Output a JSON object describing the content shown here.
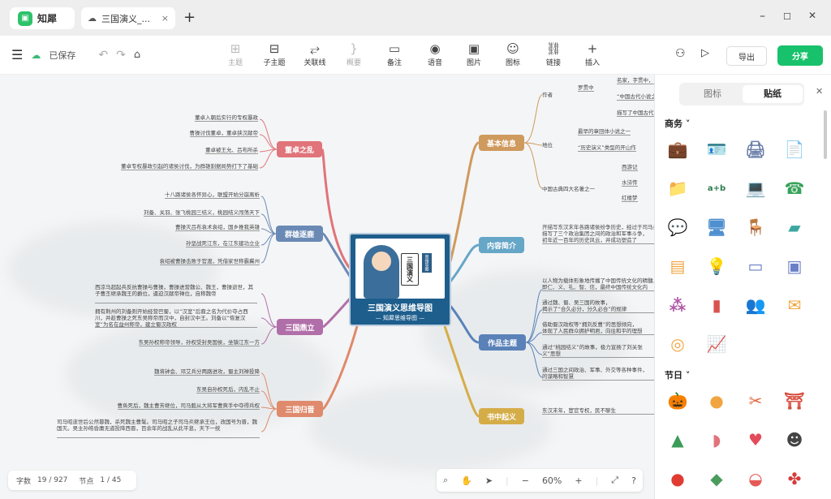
{
  "titlebar": {
    "app_name": "知犀",
    "doc_tab": "三国演义_...",
    "close": "×",
    "new_tab": "+",
    "minimize": "–",
    "maximize": "☐",
    "close_window": "✕"
  },
  "toolbar": {
    "saved_status": "已保存",
    "tools": [
      {
        "label": "主题",
        "icon": "⊞",
        "disabled": true
      },
      {
        "label": "子主题",
        "icon": "⊟",
        "disabled": false
      },
      {
        "label": "关联线",
        "icon": "⥂",
        "disabled": false
      },
      {
        "label": "概要",
        "icon": "}",
        "disabled": true
      },
      {
        "label": "备注",
        "icon": "▭",
        "disabled": false
      },
      {
        "label": "语音",
        "icon": "◉",
        "disabled": false
      },
      {
        "label": "图片",
        "icon": "▣",
        "disabled": false
      },
      {
        "label": "图标",
        "icon": "☺",
        "disabled": false
      },
      {
        "label": "链接",
        "icon": "⛓",
        "disabled": false
      },
      {
        "label": "插入",
        "icon": "+",
        "disabled": false
      }
    ],
    "export_label": "导出",
    "share_label": "分享"
  },
  "colors": {
    "accent": "#18c16b",
    "central": "#1d5e8d"
  },
  "mindmap": {
    "central_title": "三国演义思维导图",
    "central_sub": "— 知犀思维导图 —",
    "central_vertical": "三国演义",
    "central_badge": "思维导图",
    "branches": [
      {
        "label": "董卓之乱",
        "color": "#e0747a"
      },
      {
        "label": "群雄逐鹿",
        "color": "#6a8ab5"
      },
      {
        "label": "三国鼎立",
        "color": "#b16fa9"
      },
      {
        "label": "三国归晋",
        "color": "#df8a6c"
      },
      {
        "label": "基本信息",
        "color": "#cf9a5e"
      },
      {
        "label": "内容简介",
        "color": "#66a6c7"
      },
      {
        "label": "作品主题",
        "color": "#5a82b8"
      },
      {
        "label": "书中起义",
        "color": "#d5ad48"
      }
    ],
    "left_leaves": {
      "b0": [
        "董卓入朝后实行的专权暴政",
        "曹操讨伐董卓，董卓挟汉献帝",
        "董卓被王允、吕布所杀",
        "董卓专权暴政引起的诸侯讨伐，为群雄割据局势打下了基础"
      ],
      "b1": [
        "十八路诸侯各怀异心，联盟开始分崩离析",
        "刘备、关羽、张飞桃园三结义，桃园结义闯荡天下",
        "曹操灭吕布袁术袁绍，国乡推我英雄",
        "孙坚战死江东，在江东建功立业",
        "袁绍被曹操击败于官渡，凭借家世称霸冀州"
      ],
      "b2": [
        "西凉马超起兵反抗曹操与曹操，曹操进营魏公、魏王，曹操逝世，其子曹丕继承魏王的爵位，逼迫汉献帝禅位，自称魏帝",
        "拥有荆州的刘备则开始经营巴蜀，以“汉室”后裔之名为代价夺占西川，并趁曹操之死东吴称帝而汉中，自封汉中王。刘备以“恢复汉室”为名在益州称帝，建立蜀汉政权",
        "东吴孙权称帝领导，孙权受封吴国侯，坐镇江东一方"
      ],
      "b3": [
        "魏将钟会、邓艾兵分两路进攻，蜀主刘禅投降",
        "东吴自孙权死后，内乱不止",
        "曹奂死后，魏主曹芳继位，司马懿从大将军曹爽手中夺得兵权",
        "司马昭逝世后公然篡魏，杀死魏主曹髦。司马昭之子司马炎继承王位，改国号为晋，魏国灭。吴主孙皓昏庸无道投降西晋，百余年的战乱从此平息，天下一统"
      ]
    },
    "right_leaves": {
      "author": "作者",
      "author_sub": "罗贯中",
      "author_items": [
        "名家，字贯中，号湖海散人",
        "“中国古代小说之父”",
        "描写了中国古代"
      ],
      "status": "地位",
      "status_items": [
        "最早的章回体小说之一",
        "“历史演义”类型的开山作"
      ],
      "classics": "中国古典四大名著之一",
      "classics_items": [
        "西游记",
        "水浒传",
        "红楼梦"
      ],
      "intro": [
        "开描写东汉末年各路诸侯纷争历史，经过于司马炎灭吴开晋，以",
        "描写了三个政治集团之间的政治和军事斗争，",
        "初年近一百年的历史风云，并成功塑造了"
      ],
      "themes": [
        "以人物为载体形象地传播了中国传统文化的精髓，",
        "即仁、义、礼、智、信，最终中国传统文化内",
        "通过魏、蜀、吴三国的故事，",
        "揭示了“合久必分，分久必合”的规律",
        "借助蜀汉政权等“拥刘反曹”的思想倾向，",
        "体现了人民群众拥护明君，向往和平的理想",
        "通过“桃园结义”的故事，极力宣扬了刘关张",
        "义”思想",
        "通过三国之间政治、军事、外交等各种事件，",
        "的谋略和智慧"
      ],
      "uprising": [
        "东汉末年，宦官专权，民不聊生"
      ]
    }
  },
  "status": {
    "words_label": "字数",
    "words": "19 / 927",
    "nodes_label": "节点",
    "nodes": "1 / 45"
  },
  "zoom": {
    "value": "60%",
    "minus": "−",
    "plus": "+"
  },
  "panel": {
    "tab_icons": "图标",
    "tab_stickers": "贴纸",
    "section_business": "商务",
    "section_festival": "节日",
    "business_stickers": [
      "briefcase-icon",
      "id-badge-icon",
      "printer-icon",
      "document-icon",
      "folder-icon",
      "blackboard-icon",
      "laptop-icon",
      "phone-icon",
      "chat-icon",
      "monitor-icon",
      "chair-icon",
      "stapler-icon",
      "cabinet-icon",
      "lamp-icon",
      "notebook-icon",
      "window-icon",
      "network-icon",
      "barchart-icon",
      "team-icon",
      "mail-icon",
      "coins-icon",
      "trend-icon"
    ],
    "festival_stickers": [
      "pumpkin-icon",
      "mooncake-icon",
      "tools-icon",
      "palace-icon",
      "tree-icon",
      "ghost-icon",
      "heart-arrow-icon",
      "scholar-icon",
      "lantern-icon",
      "zongzi-icon",
      "bowl-icon",
      "knot-icon"
    ]
  }
}
